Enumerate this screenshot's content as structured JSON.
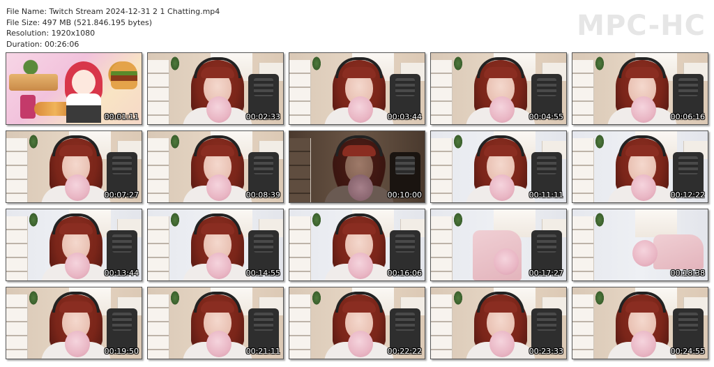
{
  "header": {
    "file_name": "File Name: Twitch Stream 2024-12-31 2 1 Chatting.mp4",
    "file_size": "File Size: 497 MB (521.846.195 bytes)",
    "resolution": "Resolution: 1920x1080",
    "duration": "Duration: 00:26:06"
  },
  "logo": "MPC-HC",
  "thumbnails": [
    {
      "time": "00:01:11"
    },
    {
      "time": "00:02:33"
    },
    {
      "time": "00:03:44"
    },
    {
      "time": "00:04:55"
    },
    {
      "time": "00:06:16"
    },
    {
      "time": "00:07:27"
    },
    {
      "time": "00:08:39"
    },
    {
      "time": "00:10:00"
    },
    {
      "time": "00:11:11"
    },
    {
      "time": "00:12:22"
    },
    {
      "time": "00:13:44"
    },
    {
      "time": "00:14:55"
    },
    {
      "time": "00:16:06"
    },
    {
      "time": "00:17:27"
    },
    {
      "time": "00:18:38"
    },
    {
      "time": "00:19:50"
    },
    {
      "time": "00:21:11"
    },
    {
      "time": "00:22:22"
    },
    {
      "time": "00:23:33"
    },
    {
      "time": "00:24:55"
    }
  ]
}
